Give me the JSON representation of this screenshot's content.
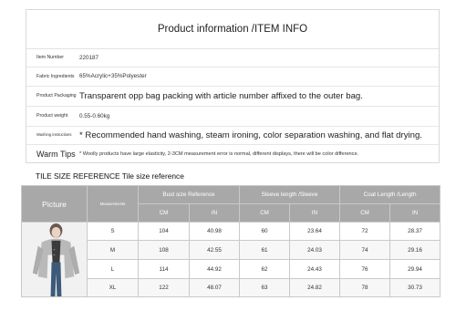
{
  "product_info": {
    "title": "Product information /ITEM INFO",
    "rows": [
      {
        "label": "Item Number",
        "value": "220187"
      },
      {
        "label": "Fabric Ingredients",
        "value": "65%Acrylic+35%Polyester"
      },
      {
        "label": "Product Packaging",
        "value": "Transparent opp bag packing with article number affixed to the outer bag."
      },
      {
        "label": "Product weight",
        "value": "0.55-0.60kg"
      },
      {
        "label": "Washing instructions",
        "value": "* Recommended hand washing, steam ironing, color separation washing, and flat drying."
      },
      {
        "label": "Warm Tips",
        "value": "* Woolly products have large elasticity, 2-3CM measurement error is normal, different displays, there will be color difference."
      }
    ]
  },
  "size_table": {
    "heading": "TILE SIZE REFERENCE Tile size reference",
    "picture_label": "Picture",
    "measure_label": "Measurements",
    "groups": [
      "Bust size Reference",
      "Sleeve length /Sleeve",
      "Coat Length /Length"
    ],
    "units": [
      "CM",
      "IN",
      "CM",
      "IN",
      "CM",
      "IN"
    ],
    "rows": [
      {
        "size": "S",
        "values": [
          "104",
          "40.98",
          "60",
          "23.64",
          "72",
          "28.37"
        ]
      },
      {
        "size": "M",
        "values": [
          "108",
          "42.55",
          "61",
          "24.03",
          "74",
          "29.16"
        ]
      },
      {
        "size": "L",
        "values": [
          "114",
          "44.92",
          "62",
          "24.43",
          "76",
          "29.94"
        ]
      },
      {
        "size": "XL",
        "values": [
          "122",
          "48.07",
          "63",
          "24.82",
          "78",
          "30.73"
        ]
      }
    ]
  }
}
